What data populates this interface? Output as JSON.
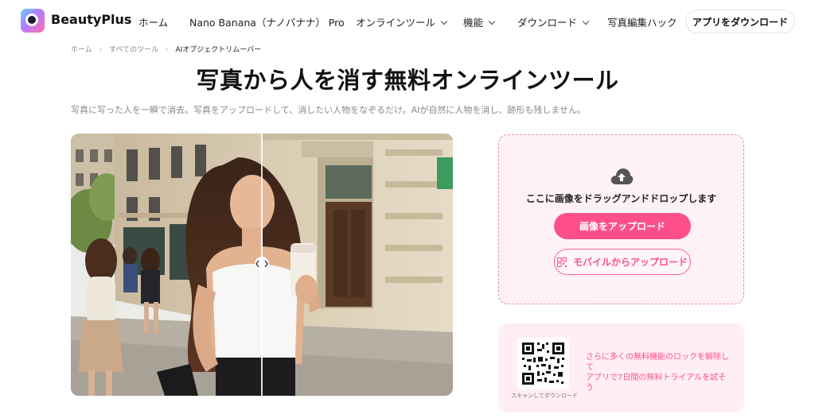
{
  "header": {
    "brand": "BeautyPlus",
    "nav": [
      {
        "label": "ホーム",
        "dropdown": false
      },
      {
        "label": "Nano Banana（ナノバナナ） Pro",
        "dropdown": false
      },
      {
        "label": "オンラインツール",
        "dropdown": true
      },
      {
        "label": "機能",
        "dropdown": true
      },
      {
        "label": "ダウンロード",
        "dropdown": true
      },
      {
        "label": "写真編集ハック",
        "dropdown": false
      }
    ],
    "cta": "アプリをダウンロード"
  },
  "breadcrumb": [
    "ホーム",
    "すべてのツール",
    "AIオブジェクトリムーバー"
  ],
  "page": {
    "title": "写真から人を消す無料オンラインツール",
    "subtitle": "写真に写った人を一瞬で消去。写真をアップロードして、消したい人物をなぞるだけ。AIが自然に人物を消し、跡形も残しません。"
  },
  "uploader": {
    "drop_text": "ここに画像をドラッグアンドドロップします",
    "upload_button": "画像をアップロード",
    "mobile_button": "モバイルからアップロード"
  },
  "promo": {
    "qr_caption": "スキャンしてダウンロード",
    "line1": "さらに多くの無料機能のロックを解除して",
    "line2": "アプリで7日間の無料トライアルを試そう"
  },
  "colors": {
    "accent": "#ff4f8b",
    "upload_bg": "#fff2f6",
    "promo_bg": "#ffeef4"
  }
}
